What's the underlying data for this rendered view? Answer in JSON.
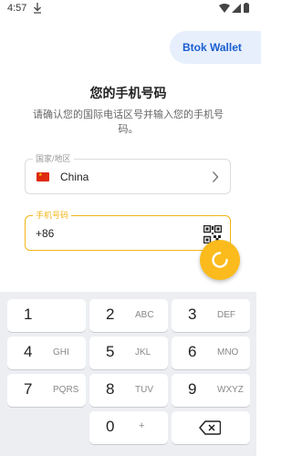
{
  "status": {
    "time": "4:57"
  },
  "header": {
    "wallet_button": "Btok Wallet"
  },
  "page": {
    "title": "您的手机号码",
    "subtitle": "请确认您的国际电话区号并输入您的手机号码。"
  },
  "country_field": {
    "label": "国家/地区",
    "value": "China"
  },
  "phone_field": {
    "label": "手机号码",
    "prefix": "+86",
    "value": ""
  },
  "keypad": {
    "keys": [
      {
        "num": "1",
        "letters": ""
      },
      {
        "num": "2",
        "letters": "ABC"
      },
      {
        "num": "3",
        "letters": "DEF"
      },
      {
        "num": "4",
        "letters": "GHI"
      },
      {
        "num": "5",
        "letters": "JKL"
      },
      {
        "num": "6",
        "letters": "MNO"
      },
      {
        "num": "7",
        "letters": "PQRS"
      },
      {
        "num": "8",
        "letters": "TUV"
      },
      {
        "num": "9",
        "letters": "WXYZ"
      },
      {
        "num": "0",
        "letters": "+"
      }
    ]
  },
  "colors": {
    "accent": "#f2b517",
    "fab": "#fbbb1c",
    "wallet_text": "#1a5ecf",
    "wallet_bg": "#e7effd"
  }
}
